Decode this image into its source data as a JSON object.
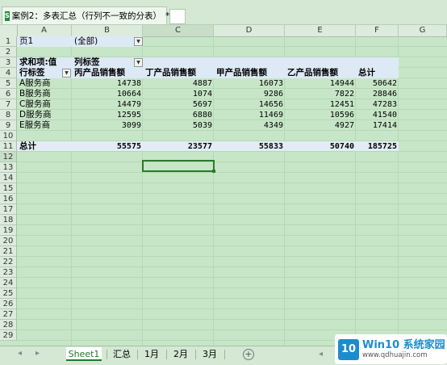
{
  "document_tab": {
    "icon": "excel-file-icon",
    "title": "案例2：多表汇总（行列不一致的分表）",
    "modified": "*",
    "close": "×"
  },
  "columns": [
    "A",
    "B",
    "C",
    "D",
    "E",
    "F",
    "G"
  ],
  "rows": [
    "1",
    "2",
    "3",
    "4",
    "5",
    "6",
    "7",
    "8",
    "9",
    "10",
    "11",
    "12",
    "13",
    "14",
    "15",
    "16",
    "17",
    "18",
    "19",
    "20",
    "21",
    "22",
    "23",
    "24",
    "25",
    "26",
    "27",
    "28",
    "29"
  ],
  "pivot": {
    "page_field_label": "页1",
    "page_field_value": "(全部)",
    "values_label": "求和项:值",
    "column_labels": "列标签",
    "row_labels": "行标签",
    "headers": [
      "丙产品销售额",
      "丁产品销售额",
      "甲产品销售额",
      "乙产品销售额",
      "总计"
    ],
    "data_rows": [
      {
        "label": "A服务商",
        "values": [
          "14738",
          "4887",
          "16073",
          "14944",
          "50642"
        ]
      },
      {
        "label": "B服务商",
        "values": [
          "10664",
          "1074",
          "9286",
          "7822",
          "28846"
        ]
      },
      {
        "label": "C服务商",
        "values": [
          "14479",
          "5697",
          "14656",
          "12451",
          "47283"
        ]
      },
      {
        "label": "D服务商",
        "values": [
          "12595",
          "6880",
          "11469",
          "10596",
          "41540"
        ]
      },
      {
        "label": "E服务商",
        "values": [
          "3099",
          "5039",
          "4349",
          "4927",
          "17414"
        ]
      }
    ],
    "total": {
      "label": "总计",
      "values": [
        "55575",
        "23577",
        "55833",
        "50740",
        "185725"
      ]
    }
  },
  "sheet_tabs": [
    "Sheet1",
    "汇总",
    "1月",
    "2月",
    "3月"
  ],
  "active_sheet": "Sheet1",
  "nav": {
    "prev": "◂",
    "next": "▸",
    "add": "+"
  },
  "watermark": {
    "logo_text": "10",
    "title": "Win10 系统家园",
    "url": "www.qdhuajin.com"
  }
}
